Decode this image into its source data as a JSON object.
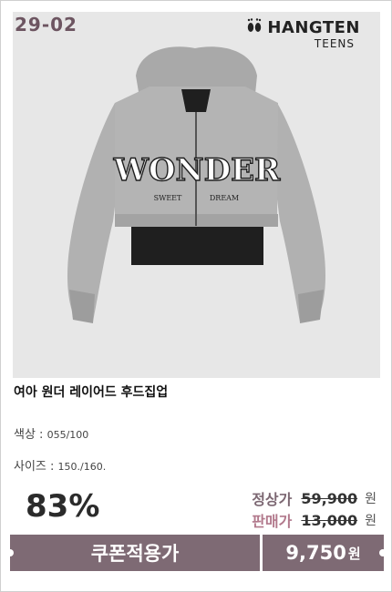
{
  "product": {
    "code": "29-02",
    "brand_name": "HANGTEN",
    "brand_sub": "TEENS",
    "name": "여아 원더 레이어드 후드집업",
    "color_label": "색상 : ",
    "color_value": "055/100",
    "size_label": "사이즈 : ",
    "size_value": "150./160.",
    "graphic_text_main": "WONDER",
    "graphic_text_left": "SWEET",
    "graphic_text_right": "DREAM"
  },
  "pricing": {
    "discount": "83%",
    "regular_label": "정상가",
    "regular_price": "59,900",
    "sale_label": "판매가",
    "sale_price": "13,000",
    "won": "원",
    "coupon_button": "쿠폰적용가",
    "final_price": "9,750",
    "final_won": "원"
  },
  "colors": {
    "accent": "#7e6a74",
    "code_color": "#6d5561",
    "regular_label": "#7c6772",
    "sale_label": "#b2798c"
  }
}
